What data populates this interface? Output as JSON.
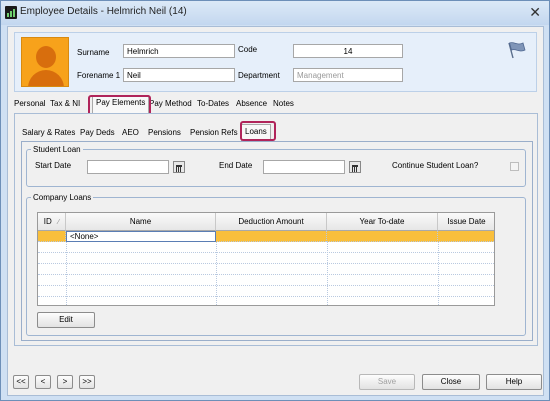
{
  "window": {
    "title": "Employee Details - Helmrich Neil (14)"
  },
  "employee": {
    "surname_label": "Surname",
    "surname": "Helmrich",
    "forename_label": "Forename 1",
    "forename": "Neil",
    "code_label": "Code",
    "code": "14",
    "department_label": "Department",
    "department": "Management"
  },
  "main_tabs": [
    "Personal",
    "Tax & NI",
    "Pay Elements",
    "Pay Method",
    "To-Dates",
    "Absence",
    "Notes"
  ],
  "sub_tabs": [
    "Salary & Rates",
    "Pay Deds",
    "AEO",
    "Pensions",
    "Pension Refs",
    "Loans"
  ],
  "student_loan": {
    "legend": "Student Loan",
    "start_date_label": "Start Date",
    "start_date": "",
    "end_date_label": "End Date",
    "end_date": "",
    "continue_label": "Continue Student Loan?"
  },
  "company_loans": {
    "legend": "Company Loans",
    "columns": [
      "ID",
      "Name",
      "Deduction Amount",
      "Year To-date",
      "Issue Date"
    ],
    "rows": [
      {
        "id": "",
        "name": "<None>",
        "deduction": "",
        "ytd": "",
        "issue": ""
      }
    ],
    "edit_label": "Edit"
  },
  "footer": {
    "nav": [
      "<<",
      "<",
      ">",
      ">>"
    ],
    "save_label": "Save",
    "close_label": "Close",
    "help_label": "Help"
  },
  "colors": {
    "highlight": "#b0245a",
    "selected_row": "#f9bf3c",
    "avatar": "#f7a21b"
  },
  "icons": {
    "window": "app-icon",
    "flag": "flag-icon",
    "calendar": "calendar-icon"
  }
}
